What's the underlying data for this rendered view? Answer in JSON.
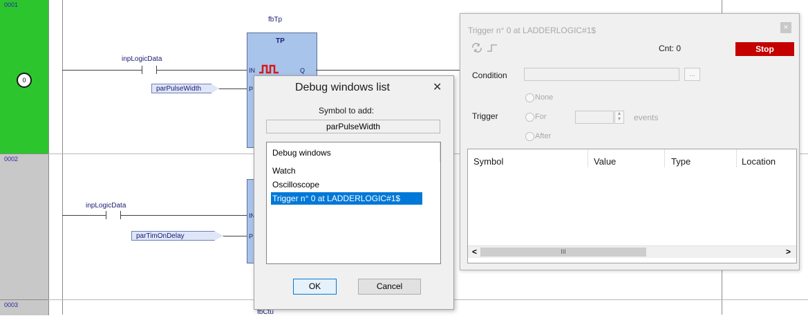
{
  "rungs": [
    {
      "number": "0001",
      "badge": "0"
    },
    {
      "number": "0002"
    },
    {
      "number": "0003"
    }
  ],
  "rung1": {
    "contact_label": "inpLogicData",
    "param": "parPulseWidth",
    "instance": "fbTp",
    "block_type": "TP",
    "pin_in": "IN",
    "pin_q": "Q",
    "pin_p": "P"
  },
  "rung2": {
    "contact_label": "inpLogicData",
    "param": "parTimOnDelay",
    "pin_in": "IN",
    "pin_p": "P"
  },
  "rung3": {
    "instance": "fbCtu"
  },
  "debug_dialog": {
    "title": "Debug windows list",
    "symbol_label": "Symbol to add:",
    "symbol_value": "parPulseWidth",
    "list_header": "Debug windows",
    "items": [
      {
        "label": "Watch",
        "selected": false
      },
      {
        "label": "Oscilloscope",
        "selected": false
      },
      {
        "label": "Trigger n° 0 at LADDERLOGIC#1$",
        "selected": true
      }
    ],
    "ok_label": "OK",
    "cancel_label": "Cancel",
    "close_glyph": "✕"
  },
  "trigger_window": {
    "title": "Trigger n° 0 at LADDERLOGIC#1$",
    "close_glyph": "×",
    "count_label": "Cnt: 0",
    "stop_label": "Stop",
    "condition_label": "Condition",
    "condition_value": "",
    "browse_label": "...",
    "trigger_label": "Trigger",
    "option_none": "None",
    "option_for": "For",
    "option_after": "After",
    "events_label": "events",
    "events_value": "",
    "columns": [
      "Symbol",
      "Value",
      "Type",
      "Location"
    ],
    "scroll_left": "<",
    "scroll_mid": "III",
    "scroll_right": ">"
  },
  "colors": {
    "rung_active": "#2dc52d",
    "rung_inactive": "#c8c8c8",
    "stop_button": "#c40000",
    "selection": "#0078d7",
    "block_fill": "#a9c4ea",
    "pulse_red": "#d81818"
  },
  "icons": {
    "refresh": "refresh-icon",
    "rising_edge": "rising-edge-icon"
  }
}
